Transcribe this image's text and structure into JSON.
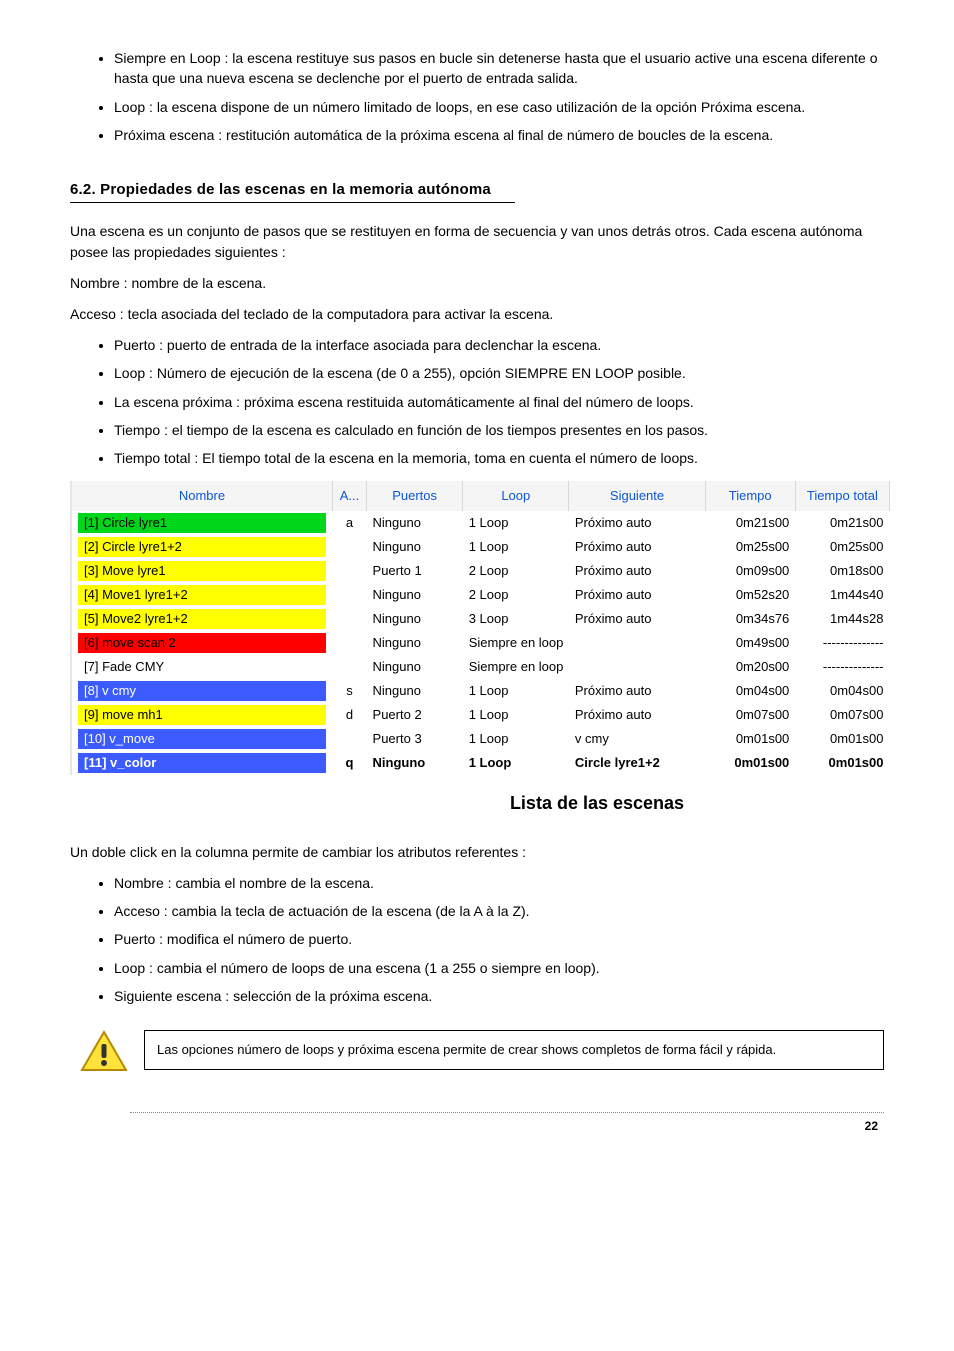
{
  "top_bullets": [
    "Siempre en Loop : la escena restituye sus pasos en bucle sin detenerse hasta que el usuario active una escena diferente o hasta que una nueva escena se declenche por el puerto de entrada salida.",
    "Loop : la escena dispone de un número limitado de loops, en ese caso utilización de la opción Próxima escena.",
    "Próxima escena : restitución automática de la próxima escena al final de número de boucles de la escena."
  ],
  "section_title": "6.2. Propiedades de las escenas en la memoria autónoma",
  "intro_paragraphs": [
    "Una escena es un conjunto de pasos que se restituyen en forma de secuencia y van unos detrás otros. Cada escena autónoma posee las propiedades siguientes :",
    "Nombre : nombre de la escena.",
    "Acceso : tecla asociada del teclado de la computadora para activar la escena."
  ],
  "mid_bullets": [
    "Puerto : puerto de entrada de la interface asociada para declenchar la escena.",
    "Loop : Número de ejecución de la escena (de 0 a 255), opción SIEMPRE EN LOOP posible.",
    "La escena próxima : próxima escena restituida automáticamente al final del número de loops.",
    "Tiempo : el tiempo de la escena es calculado en función de los tiempos presentes en los pasos.",
    "Tiempo total : El tiempo total de la escena en la memoria, toma en cuenta el número de loops."
  ],
  "table": {
    "headers": [
      "Nombre",
      "A...",
      "Puertos",
      "Loop",
      "Siguiente",
      "Tiempo",
      "Tiempo total"
    ],
    "rows": [
      {
        "name": "[1] Circle lyre1",
        "a": "a",
        "port": "Ninguno",
        "loop": "1 Loop",
        "next": "Próximo auto",
        "time": "0m21s00",
        "total": "0m21s00",
        "chip": "chip-green"
      },
      {
        "name": "[2] Circle lyre1+2",
        "a": "",
        "port": "Ninguno",
        "loop": "1 Loop",
        "next": "Próximo auto",
        "time": "0m25s00",
        "total": "0m25s00",
        "chip": "chip-yellow"
      },
      {
        "name": "[3] Move lyre1",
        "a": "",
        "port": "Puerto 1",
        "loop": "2 Loop",
        "next": "Próximo auto",
        "time": "0m09s00",
        "total": "0m18s00",
        "chip": "chip-yellow"
      },
      {
        "name": "[4] Move1 lyre1+2",
        "a": "",
        "port": "Ninguno",
        "loop": "2 Loop",
        "next": "Próximo auto",
        "time": "0m52s20",
        "total": "1m44s40",
        "chip": "chip-yellow"
      },
      {
        "name": "[5] Move2 lyre1+2",
        "a": "",
        "port": "Ninguno",
        "loop": "3 Loop",
        "next": "Próximo auto",
        "time": "0m34s76",
        "total": "1m44s28",
        "chip": "chip-yellow"
      },
      {
        "name": "[6] move scan 2",
        "a": "",
        "port": "Ninguno",
        "loop": "Siempre en loop",
        "next": "",
        "time": "0m49s00",
        "total": "--------------",
        "chip": "chip-red"
      },
      {
        "name": "[7] Fade CMY",
        "a": "",
        "port": "Ninguno",
        "loop": "Siempre en loop",
        "next": "",
        "time": "0m20s00",
        "total": "--------------",
        "chip": "chip-none"
      },
      {
        "name": "[8] v cmy",
        "a": "s",
        "port": "Ninguno",
        "loop": "1 Loop",
        "next": "Próximo auto",
        "time": "0m04s00",
        "total": "0m04s00",
        "chip": "chip-blue"
      },
      {
        "name": "[9] move mh1",
        "a": "d",
        "port": "Puerto 2",
        "loop": "1 Loop",
        "next": "Próximo auto",
        "time": "0m07s00",
        "total": "0m07s00",
        "chip": "chip-yellow"
      },
      {
        "name": "[10] v_move",
        "a": "",
        "port": "Puerto 3",
        "loop": "1 Loop",
        "next": "v cmy",
        "time": "0m01s00",
        "total": "0m01s00",
        "chip": "chip-blue"
      },
      {
        "name": "[11] v_color",
        "a": "q",
        "port": "Ninguno",
        "loop": "1 Loop",
        "next": "Circle lyre1+2",
        "time": "0m01s00",
        "total": "0m01s00",
        "chip": "chip-blue-bold",
        "bold": true
      }
    ]
  },
  "caption": "Lista de las escenas",
  "after_caption": "Un doble click en la columna permite de cambiar los atributos referentes :",
  "after_bullets": [
    "Nombre : cambia el nombre de la escena.",
    "Acceso : cambia la tecla de actuación de la escena (de la A à la Z).",
    "Puerto : modifica el número de puerto.",
    "Loop : cambia el número de loops de una escena (1 a 255 o siempre en loop).",
    "Siguiente escena : selección de la próxima escena."
  ],
  "alert_text": "Las opciones número de loops y próxima escena permite de crear shows completos de forma fácil y rápida.",
  "page_number": "22"
}
